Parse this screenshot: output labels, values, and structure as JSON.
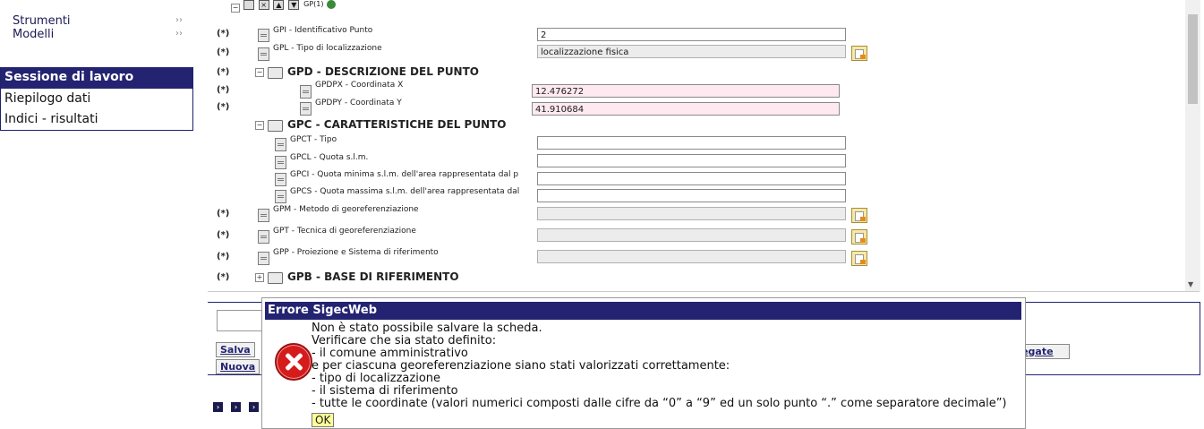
{
  "sidebar": {
    "top_links": [
      {
        "label": "Strumenti",
        "chevron": "››"
      },
      {
        "label": "Modelli",
        "chevron": "››"
      }
    ],
    "session_title": "Sessione di lavoro",
    "session_items": [
      "Riepilogo dati",
      "Indici - risultati"
    ]
  },
  "form": {
    "toolbar_suffix": "GP(1)",
    "rows": [
      {
        "star": "(*)",
        "label": "GPI - Identificativo Punto",
        "value": "2"
      },
      {
        "star": "(*)",
        "label": "GPL - Tipo di localizzazione",
        "value": "localizzazione fisica"
      },
      {
        "star": "(*)",
        "group": "GPD - DESCRIZIONE DEL PUNTO"
      },
      {
        "star": "(*)",
        "label": "GPDPX - Coordinata X",
        "value": "12.476272"
      },
      {
        "star": "(*)",
        "label": "GPDPY - Coordinata Y",
        "value": "41.910684"
      },
      {
        "group": "GPC - CARATTERISTICHE DEL PUNTO"
      },
      {
        "label": "GPCT - Tipo",
        "value": ""
      },
      {
        "label": "GPCL - Quota s.l.m.",
        "value": ""
      },
      {
        "label": "GPCI - Quota minima s.l.m. dell'area rappresentata dal p",
        "value": ""
      },
      {
        "label": "GPCS - Quota massima s.l.m. dell'area rappresentata dal",
        "value": ""
      },
      {
        "star": "(*)",
        "label": "GPM - Metodo di georeferenziazione",
        "value": ""
      },
      {
        "star": "(*)",
        "label": "GPT - Tecnica di georeferenziazione",
        "value": ""
      },
      {
        "star": "(*)",
        "label": "GPP - Proiezione e Sistema di riferimento",
        "value": ""
      },
      {
        "star": "(*)",
        "group": "GPB - BASE DI RIFERIMENTO"
      }
    ]
  },
  "lower": {
    "save_label": "Salva",
    "new_label": "Nuova",
    "linked_label": "ollegate"
  },
  "dialog": {
    "title": "Errore SigecWeb",
    "lines": [
      "Non è stato possibile salvare la scheda.",
      "Verificare che sia stato definito:",
      "- il comune amministrativo",
      "e per ciascuna georeferenziazione siano stati valorizzati correttamente:",
      "- tipo di localizzazione",
      "- il sistema di riferimento",
      "- tutte le coordinate (valori numerici composti dalle cifre da “0” a “9” ed un solo punto “.” come separatore decimale”)"
    ],
    "ok_label": "OK"
  }
}
